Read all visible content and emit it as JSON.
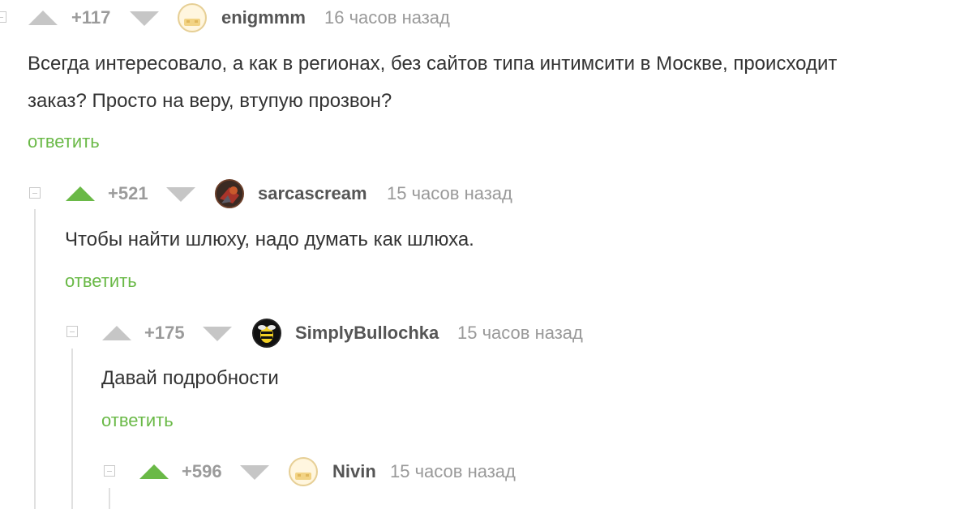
{
  "colors": {
    "upvote_active": "#6ab947",
    "vote_inactive": "#c6c6c6",
    "reply": "#6ab947"
  },
  "comments": [
    {
      "rating": "+117",
      "username": "enigmmm",
      "time": "16 часов назад",
      "text_line1": "Всегда интересовало, а как в регионах, без сайтов типа интимсити в Москве, происходит",
      "text_line2": "заказ? Просто на веру, втупую прозвон?",
      "reply": "ответить",
      "upvoted": false
    },
    {
      "rating": "+521",
      "username": "sarcascream",
      "time": "15 часов назад",
      "text": "Чтобы найти шлюху, надо думать как шлюха.",
      "reply": "ответить",
      "upvoted": true
    },
    {
      "rating": "+175",
      "username": "SimplyBullochka",
      "time": "15 часов назад",
      "text": "Давай подробности",
      "reply": "ответить",
      "upvoted": false
    },
    {
      "rating": "+596",
      "username": "Nivin",
      "time": "15 часов назад",
      "upvoted": true
    }
  ]
}
